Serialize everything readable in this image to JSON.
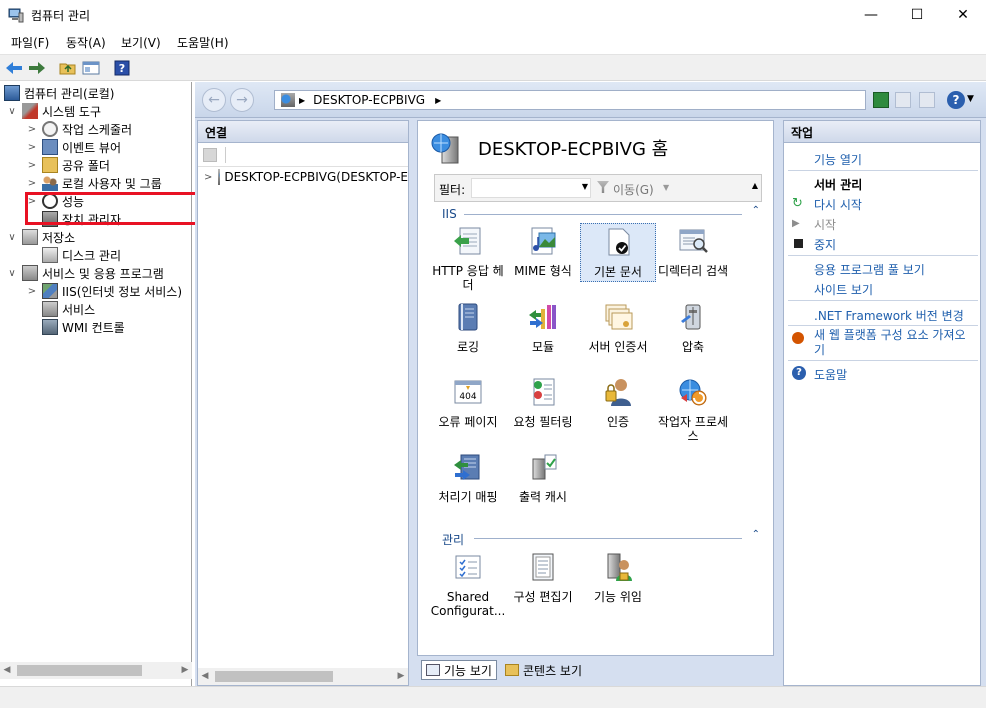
{
  "window": {
    "title": "컴퓨터 관리",
    "minimize": "—",
    "maximize": "☐",
    "close": "✕"
  },
  "menu": [
    "파일(F)",
    "동작(A)",
    "보기(V)",
    "도움말(H)"
  ],
  "tree": [
    {
      "label": "컴퓨터 관리(로컬)",
      "expander": "",
      "icon": "computer-management-icon"
    },
    {
      "label": "시스템 도구",
      "expander": "∨",
      "icon": "tools-icon"
    },
    {
      "label": "작업 스케줄러",
      "expander": ">",
      "icon": "clock-icon"
    },
    {
      "label": "이벤트 뷰어",
      "expander": ">",
      "icon": "event-viewer-icon"
    },
    {
      "label": "공유 폴더",
      "expander": ">",
      "icon": "shared-folder-icon"
    },
    {
      "label": "로컬 사용자 및 그룹",
      "expander": ">",
      "icon": "users-icon"
    },
    {
      "label": "성능",
      "expander": ">",
      "icon": "performance-icon"
    },
    {
      "label": "장치 관리자",
      "expander": "",
      "icon": "device-manager-icon"
    },
    {
      "label": "저장소",
      "expander": "∨",
      "icon": "storage-icon"
    },
    {
      "label": "디스크 관리",
      "expander": "",
      "icon": "disk-icon"
    },
    {
      "label": "서비스 및 응용 프로그램",
      "expander": "∨",
      "icon": "services-icon"
    },
    {
      "label": "IIS(인터넷 정보 서비스)",
      "expander": ">",
      "icon": "iis-icon"
    },
    {
      "label": "서비스",
      "expander": "",
      "icon": "service-icon"
    },
    {
      "label": "WMI 컨트롤",
      "expander": "",
      "icon": "wmi-icon"
    }
  ],
  "address": {
    "server": "DESKTOP-ECPBIVG"
  },
  "connections": {
    "title": "연결",
    "server_node": "DESKTOP-ECPBIVG(DESKTOP-E"
  },
  "center": {
    "title": "DESKTOP-ECPBIVG 홈",
    "filter_label": "필터:",
    "go_label": "이동(G)",
    "groups": [
      {
        "name": "IIS",
        "features": [
          {
            "label": "HTTP 응답 헤더",
            "icon": "http-headers-icon"
          },
          {
            "label": "MIME 형식",
            "icon": "mime-types-icon"
          },
          {
            "label": "기본 문서",
            "icon": "default-document-icon"
          },
          {
            "label": "디렉터리 검색",
            "icon": "directory-browsing-icon"
          },
          {
            "label": "로깅",
            "icon": "logging-icon"
          },
          {
            "label": "모듈",
            "icon": "modules-icon"
          },
          {
            "label": "서버 인증서",
            "icon": "server-certificates-icon"
          },
          {
            "label": "압축",
            "icon": "compression-icon"
          },
          {
            "label": "오류 페이지",
            "icon": "error-pages-icon"
          },
          {
            "label": "요청 필터링",
            "icon": "request-filtering-icon"
          },
          {
            "label": "인증",
            "icon": "authentication-icon"
          },
          {
            "label": "작업자 프로세스",
            "icon": "worker-processes-icon"
          },
          {
            "label": "처리기 매핑",
            "icon": "handler-mappings-icon"
          },
          {
            "label": "출력 캐시",
            "icon": "output-cache-icon"
          }
        ]
      },
      {
        "name": "관리",
        "features": [
          {
            "label": "Shared Configurat...",
            "icon": "shared-configuration-icon"
          },
          {
            "label": "구성 편집기",
            "icon": "configuration-editor-icon"
          },
          {
            "label": "기능 위임",
            "icon": "feature-delegation-icon"
          }
        ]
      }
    ],
    "error_code": "404",
    "view_tabs": [
      "기능 보기",
      "콘텐츠 보기"
    ]
  },
  "actions": {
    "title": "작업",
    "open_feature": "기능 열기",
    "manage_server": "서버 관리",
    "restart": "다시 시작",
    "start": "시작",
    "stop": "중지",
    "view_app_pools": "응용 프로그램 풀 보기",
    "view_sites": "사이트 보기",
    "change_net": ".NET Framework 버전 변경",
    "get_web_platform": "새 웹 플랫폼 구성 요소 가져오기",
    "help": "도움말"
  }
}
